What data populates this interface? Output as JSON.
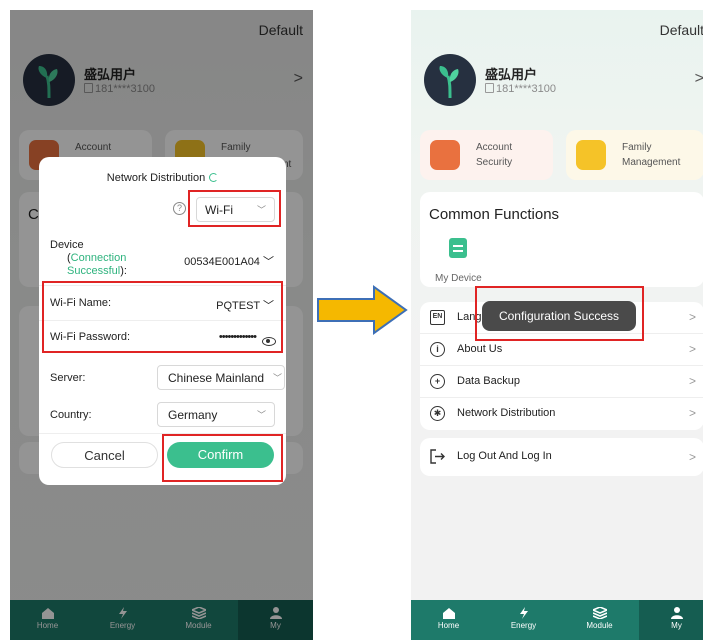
{
  "left": {
    "header": {
      "default_label": "Default"
    },
    "profile": {
      "name": "盛弘用户",
      "phone": "181****3100"
    },
    "quick": {
      "account": "Account",
      "family": "Family",
      "family_tail": "nt"
    },
    "dialog": {
      "title": "Network Distribution",
      "mode": "Wi-Fi",
      "device_label": "Device",
      "device_status_open": "(",
      "device_status": "Connection Successful",
      "device_status_close": "):",
      "device_value": "00534E001A04",
      "wifi_name_label": "Wi-Fi Name:",
      "wifi_name_value": "PQTEST",
      "wifi_password_label": "Wi-Fi Password:",
      "wifi_password_value": "•••••••••••••",
      "server_label": "Server:",
      "server_value": "Chinese Mainland",
      "country_label": "Country:",
      "country_value": "Germany",
      "cancel": "Cancel",
      "confirm": "Confirm"
    },
    "tabs": [
      "Home",
      "Energy",
      "Module",
      "My"
    ]
  },
  "right": {
    "header": {
      "default_label": "Default"
    },
    "profile": {
      "name": "盛弘用户",
      "phone": "181****3100"
    },
    "quick": {
      "account_line1": "Account",
      "account_line2": "Security",
      "family_line1": "Family",
      "family_line2": "Management"
    },
    "common": {
      "title": "Common Functions",
      "my_device": "My Device"
    },
    "menu": [
      {
        "icon": "EN",
        "label": "Language"
      },
      {
        "icon": "i",
        "label": "About Us"
      },
      {
        "icon": "+",
        "label": "Data Backup"
      },
      {
        "icon": "✱",
        "label": "Network Distribution"
      }
    ],
    "logout": "Log Out And Log In",
    "toast": "Configuration Success",
    "tabs": [
      "Home",
      "Energy",
      "Module",
      "My"
    ]
  },
  "colors": {
    "accent_green": "#3bbf8e",
    "tab_bar": "#1e7a6a",
    "highlight_red": "#e02424",
    "arrow_fill": "#f5b800",
    "arrow_stroke": "#3d6fb6"
  }
}
